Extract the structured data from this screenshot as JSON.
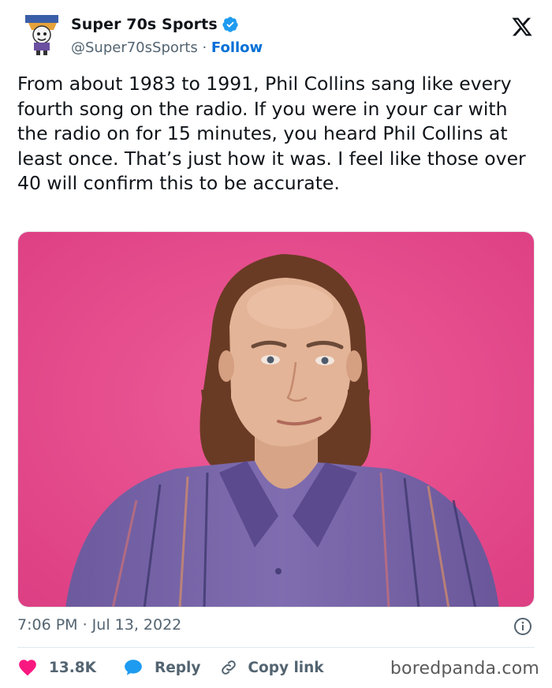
{
  "author": {
    "name": "Super 70s Sports",
    "handle": "@Super70sSports",
    "separator": " · ",
    "follow_label": "Follow"
  },
  "tweet": {
    "text": "From about 1983 to 1991, Phil Collins sang like every fourth song on the radio. If you were in your car with the radio on for 15 minutes, you heard Phil Collins at least once. That’s just how it was. I feel like those over 40 will confirm this to be accurate.",
    "timestamp": "7:06 PM · Jul 13, 2022"
  },
  "actions": {
    "likes": "13.8K",
    "reply_label": "Reply",
    "copy_label": "Copy link"
  },
  "watermark": "boredpanda.com",
  "colors": {
    "text": "#0f1419",
    "secondary": "#536471",
    "link": "#006fd6",
    "like": "#f91880",
    "reply": "#1d9bf0",
    "photo_background": "#e2498a"
  },
  "icons": {
    "verified": "verified-badge-icon",
    "x_logo": "x-logo-icon",
    "info": "info-icon",
    "like": "heart-icon",
    "reply": "speech-bubble-icon",
    "copy": "link-icon"
  }
}
